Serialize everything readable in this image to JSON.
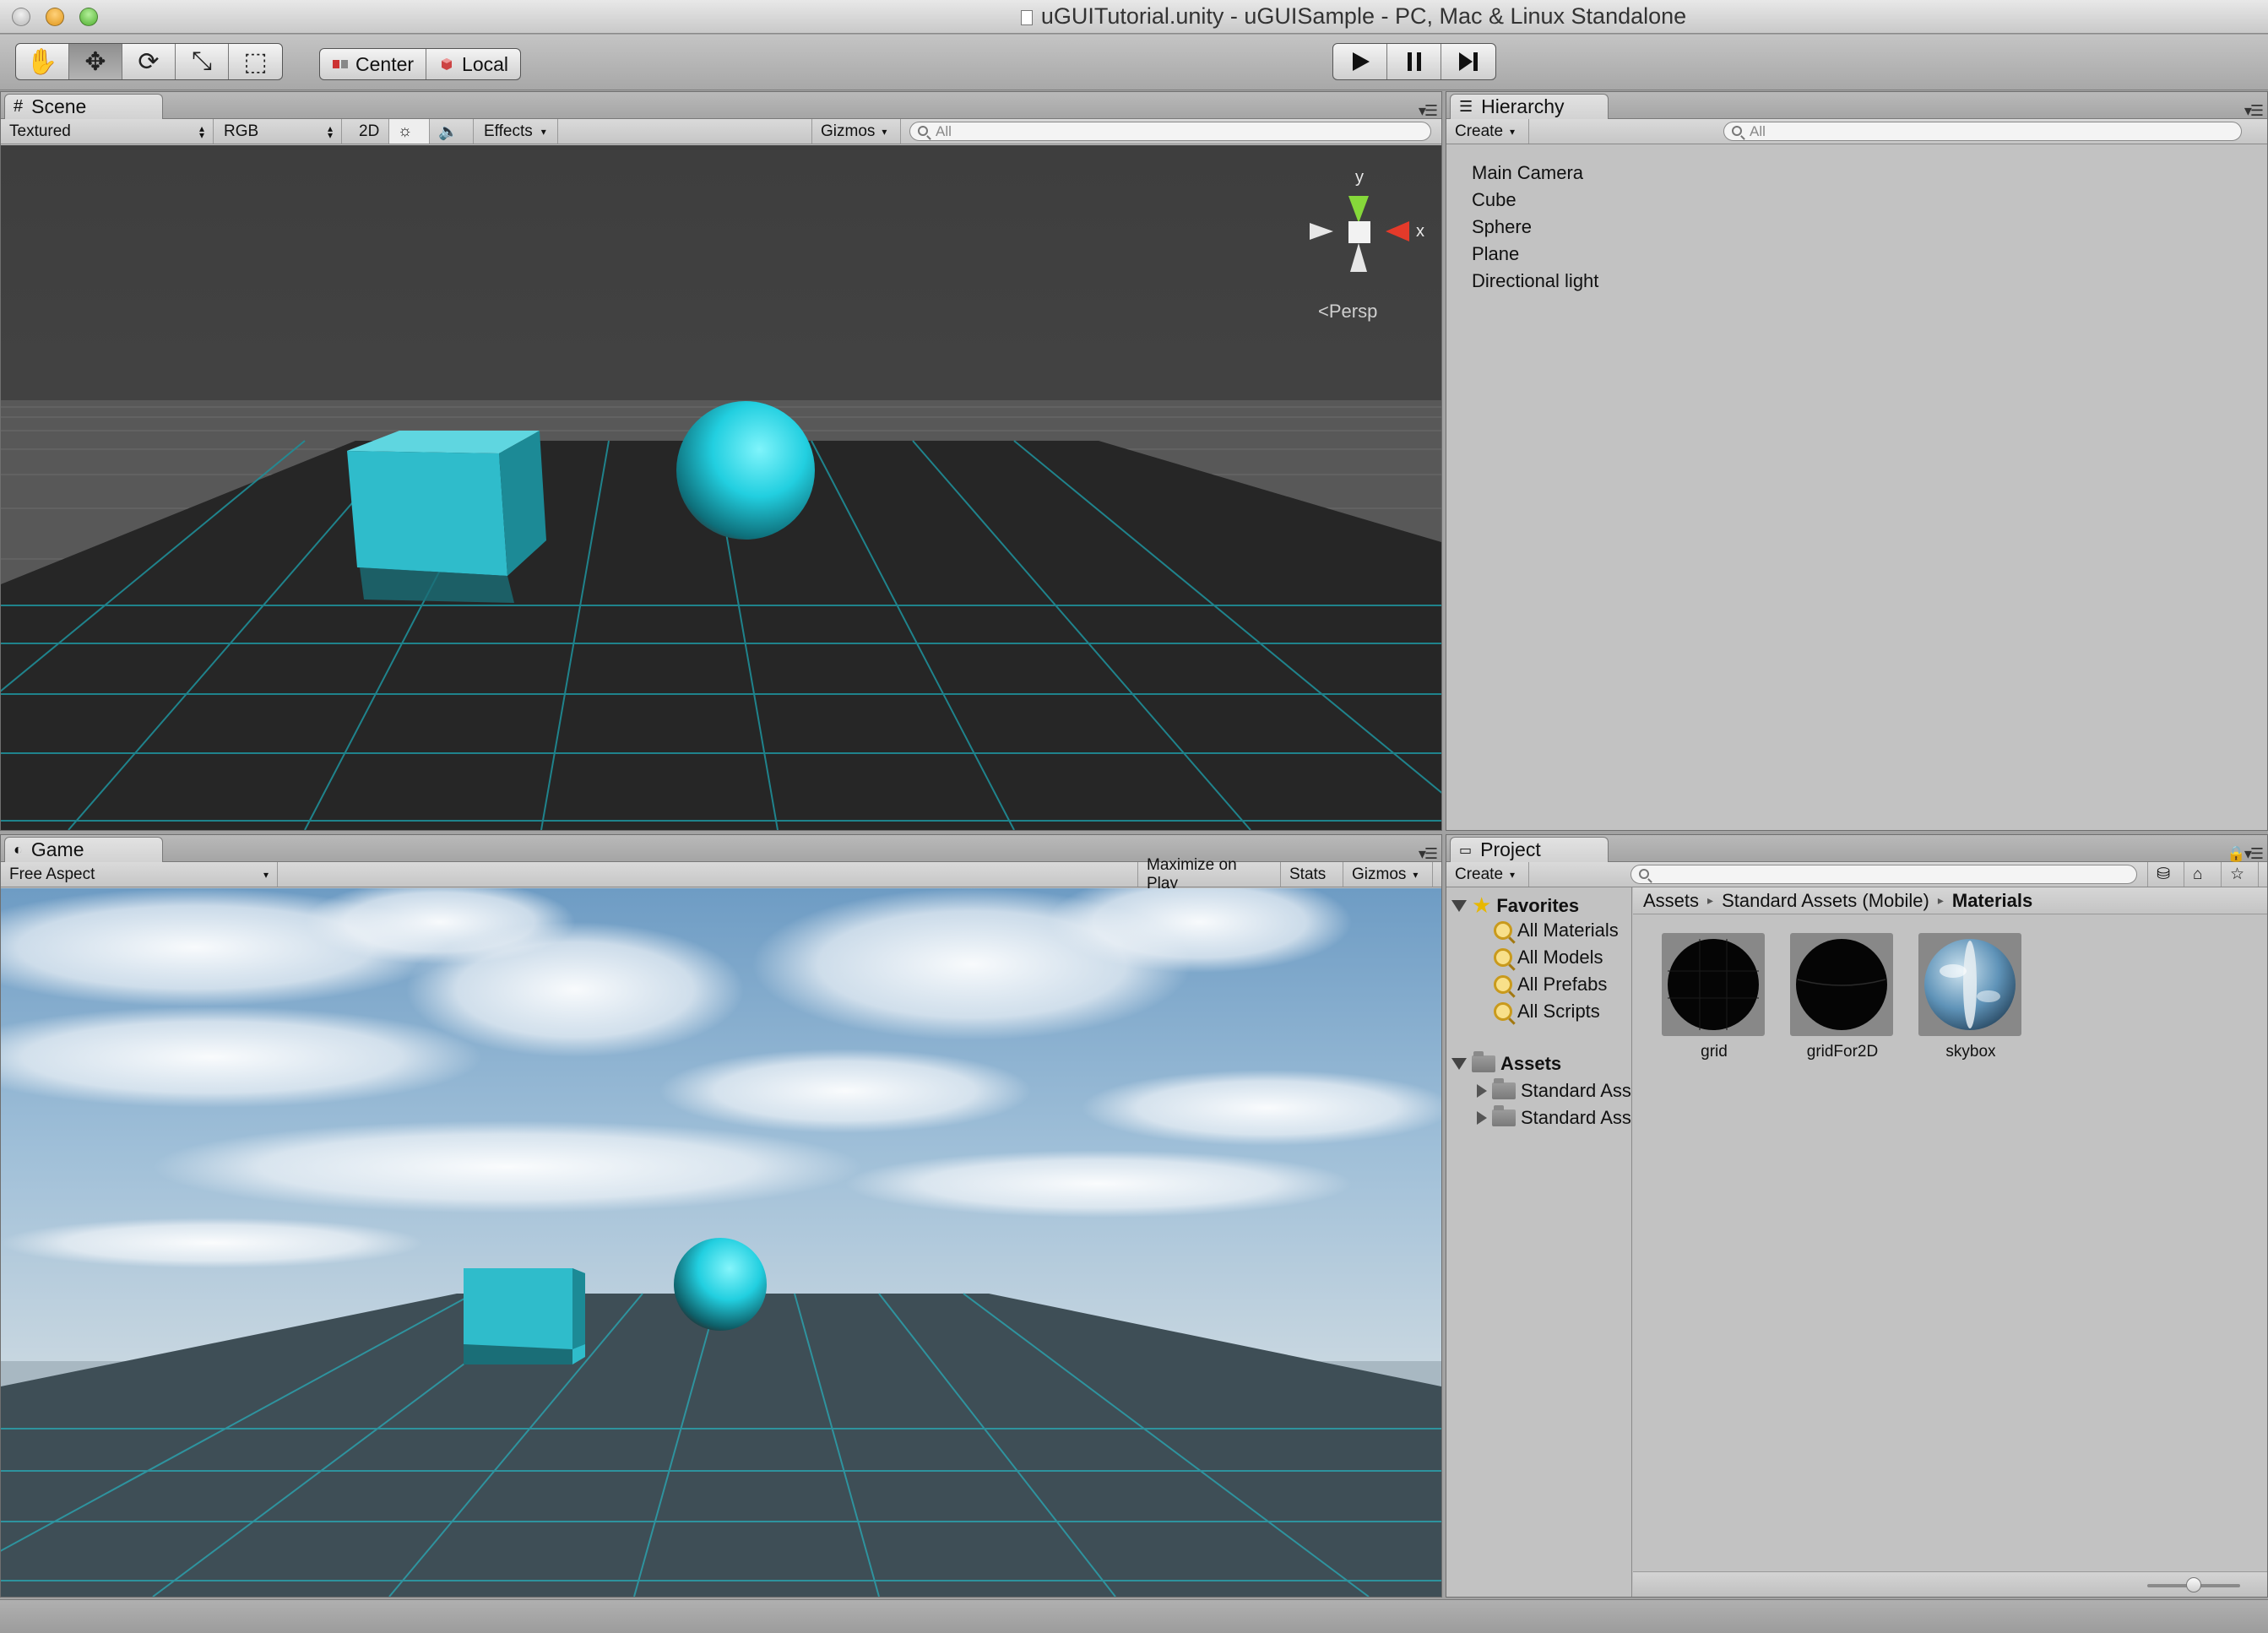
{
  "window": {
    "title": "uGUITutorial.unity - uGUISample - PC, Mac & Linux Standalone"
  },
  "toolbar": {
    "tools": [
      {
        "name": "hand-tool",
        "icon": "hand-icon",
        "glyph": "✋"
      },
      {
        "name": "move-tool",
        "icon": "move-icon",
        "glyph": "✥"
      },
      {
        "name": "rotate-tool",
        "icon": "rotate-icon",
        "glyph": "⟳"
      },
      {
        "name": "scale-tool",
        "icon": "scale-icon",
        "glyph": "⤡"
      },
      {
        "name": "rect-tool",
        "icon": "rect-icon",
        "glyph": "⬚"
      }
    ],
    "active_tool": "move-tool",
    "pivot_label": "Center",
    "space_label": "Local"
  },
  "scene": {
    "tab_label": "Scene",
    "draw_mode": "Textured",
    "render_mode": "RGB",
    "mode_2d": "2D",
    "effects_label": "Effects",
    "gizmos_label": "Gizmos",
    "search_placeholder": "All",
    "axis_y": "y",
    "axis_x": "x",
    "projection": "Persp"
  },
  "hierarchy": {
    "tab_label": "Hierarchy",
    "create_label": "Create",
    "search_placeholder": "All",
    "items": [
      "Main Camera",
      "Cube",
      "Sphere",
      "Plane",
      "Directional light"
    ]
  },
  "game": {
    "tab_label": "Game",
    "aspect": "Free Aspect",
    "maximize_label": "Maximize on Play",
    "stats_label": "Stats",
    "gizmos_label": "Gizmos"
  },
  "project": {
    "tab_label": "Project",
    "create_label": "Create",
    "search_placeholder": "",
    "favorites_label": "Favorites",
    "favorites": [
      "All Materials",
      "All Models",
      "All Prefabs",
      "All Scripts"
    ],
    "assets_label": "Assets",
    "asset_folders": [
      "Standard Assets",
      "Standard Assets (Mobile)"
    ],
    "breadcrumb": [
      "Assets",
      "Standard Assets (Mobile)",
      "Materials"
    ],
    "assets": [
      "grid",
      "gridFor2D",
      "skybox"
    ],
    "zoom": 0.5
  },
  "colors": {
    "accent_cyan": "#2fd3e0",
    "grid_cyan": "#27b6c4"
  }
}
